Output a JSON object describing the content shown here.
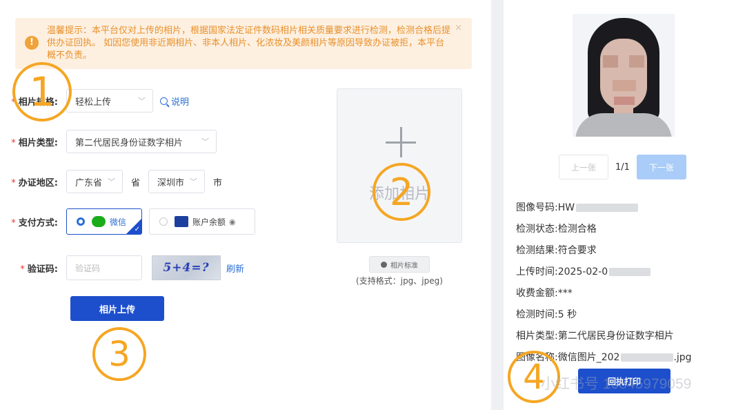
{
  "notice": {
    "text": "温馨提示：本平台仅对上传的相片，根据国家法定证件数码相片相关质量要求进行检测，检测合格后提供办证回执。 如因您使用非近期相片、非本人相片、化浓妆及美颜相片等原因导致办证被拒，本平台概不负责。",
    "icon": "warning-icon",
    "close": "×"
  },
  "form": {
    "spec": {
      "label": "相片规格:",
      "value": "轻松上传",
      "help": "说明"
    },
    "type": {
      "label": "相片类型:",
      "value": "第二代居民身份证数字相片"
    },
    "region": {
      "label": "办证地区:",
      "province": "广东省",
      "province_suffix": "省",
      "city": "深圳市",
      "city_suffix": "市"
    },
    "payment": {
      "label": "支付方式:",
      "wechat": "微信",
      "balance": "账户余额",
      "selected": "wechat"
    },
    "captcha": {
      "label": "验证码:",
      "placeholder": "验证码",
      "image_text": "5+4=?",
      "refresh": "刷新"
    },
    "submit": "相片上传"
  },
  "upload": {
    "add_label": "添加相片",
    "standard_btn": "相片标准",
    "formats": "(支持格式：jpg、jpeg)"
  },
  "markers": {
    "m1": "1",
    "m2": "2",
    "m3": "3",
    "m4": "4"
  },
  "preview": {
    "prev": "上一张",
    "page": "1/1",
    "next": "下一张",
    "info": [
      {
        "k": "图像号码:",
        "v": "HW"
      },
      {
        "k": "检测状态:",
        "v": "检测合格"
      },
      {
        "k": "检测结果:",
        "v": "符合要求"
      },
      {
        "k": "上传时间:",
        "v": "2025-02-0"
      },
      {
        "k": "收费金额:",
        "v": "***"
      },
      {
        "k": "检测时间:",
        "v": "5 秒"
      },
      {
        "k": "相片类型:",
        "v": "第二代居民身份证数字相片"
      },
      {
        "k": "图像名称:",
        "v": "微信图片_202",
        "tail": ".jpg"
      }
    ],
    "receipt_btn": "回执打印"
  },
  "watermark": "小红书号 10845979059"
}
